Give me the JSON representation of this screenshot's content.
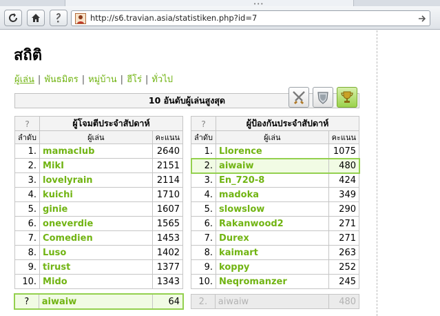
{
  "browser": {
    "url": "http://s6.travian.asia/statistiken.php?id=7"
  },
  "page": {
    "title": "สถิติ",
    "nav": [
      "ผู้เล่น",
      "พันธมิตร",
      "หมู่บ้าน",
      "ฮีโร่",
      "ทั่วไป"
    ],
    "nav_active": "ผู้เล่น",
    "top10_title": "10 อันดับผู้เล่นสูงสุด"
  },
  "attackers": {
    "q": "?",
    "title": "ผู้โจมตีประจำสัปดาห์",
    "col_rank": "ลำดับ",
    "col_player": "ผู้เล่น",
    "col_points": "คะแนน",
    "rows": [
      {
        "rank": "1.",
        "player": "mamaclub",
        "points": "2640"
      },
      {
        "rank": "2.",
        "player": "MikI",
        "points": "2151"
      },
      {
        "rank": "3.",
        "player": "lovelyrain",
        "points": "2114"
      },
      {
        "rank": "4.",
        "player": "kuichi",
        "points": "1710"
      },
      {
        "rank": "5.",
        "player": "ginie",
        "points": "1607"
      },
      {
        "rank": "6.",
        "player": "oneverdie",
        "points": "1565"
      },
      {
        "rank": "7.",
        "player": "Comedien",
        "points": "1453"
      },
      {
        "rank": "8.",
        "player": "Luso",
        "points": "1402"
      },
      {
        "rank": "9.",
        "player": "tirust",
        "points": "1377"
      },
      {
        "rank": "10.",
        "player": "Mido",
        "points": "1343"
      }
    ],
    "own": {
      "rank": "?",
      "player": "aiwaiw",
      "points": "64"
    }
  },
  "defenders": {
    "q": "?",
    "title": "ผู้ป้องกันประจำสัปดาห์",
    "col_rank": "ลำดับ",
    "col_player": "ผู้เล่น",
    "col_points": "คะแนน",
    "rows": [
      {
        "rank": "1.",
        "player": "Llorence",
        "points": "1075"
      },
      {
        "rank": "2.",
        "player": "aiwaiw",
        "points": "480"
      },
      {
        "rank": "3.",
        "player": "En_720-8",
        "points": "424"
      },
      {
        "rank": "4.",
        "player": "madoka",
        "points": "349"
      },
      {
        "rank": "5.",
        "player": "slowslow",
        "points": "290"
      },
      {
        "rank": "6.",
        "player": "Rakanwood2",
        "points": "271"
      },
      {
        "rank": "7.",
        "player": "Durex",
        "points": "271"
      },
      {
        "rank": "8.",
        "player": "kaimart",
        "points": "263"
      },
      {
        "rank": "9.",
        "player": "koppy",
        "points": "252"
      },
      {
        "rank": "10.",
        "player": "Neqromanzer",
        "points": "245"
      }
    ],
    "highlight_index": 1,
    "own": {
      "rank": "2.",
      "player": "aiwaiw",
      "points": "480"
    }
  },
  "colors": {
    "link": "#71b413",
    "highlight_border": "#93d04e",
    "highlight_bg": "#f1fbe4"
  },
  "icons": [
    "back-icon",
    "home-icon",
    "info-icon",
    "favicon-icon",
    "go-icon",
    "swords-icon",
    "shield-icon",
    "trophy-icon"
  ]
}
